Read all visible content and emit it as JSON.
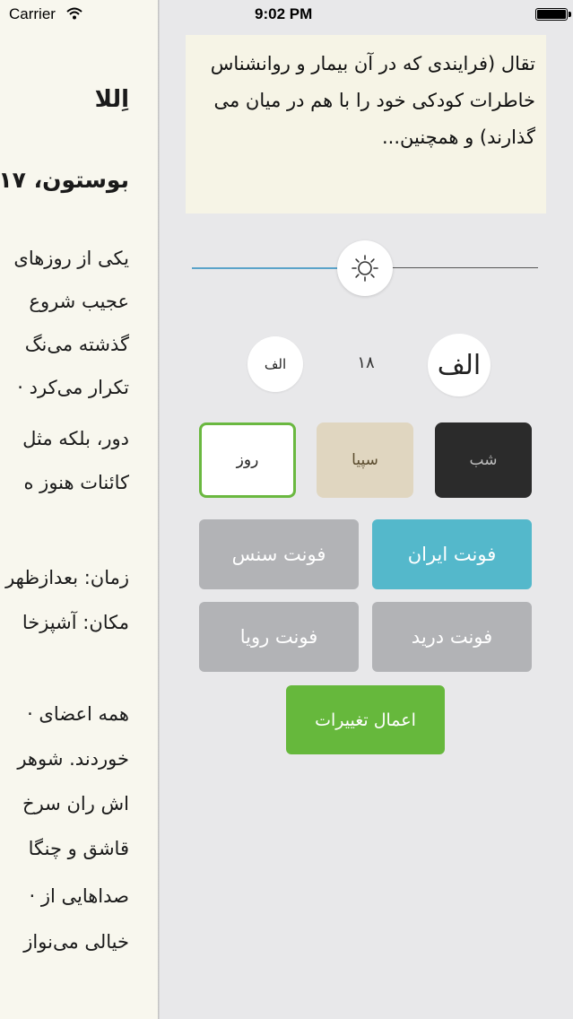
{
  "status_bar": {
    "carrier": "Carrier",
    "time": "9:02 PM"
  },
  "reader": {
    "title": "اِللا",
    "subtitle": "بوستون، ۱۷",
    "lines": [
      "یکی از روزهای",
      "عجیب شروع",
      "گذشته می‌نگ",
      "تکرار می‌کرد ·",
      "دور، بلکه مثل",
      "کائنات هنوز ه",
      "زمان: بعدازظهر",
      "مکان: آشپزخا",
      "همه اعضای ·",
      "خوردند. شوهر",
      "اش ران سرخ",
      "قاشق و چنگا",
      "صداهایی از ·",
      "خیالی می‌نواز"
    ]
  },
  "preview": {
    "text": "تقال (فرایندی که در آن بیمار و روانشناس خاطرات کودکی خود را با هم در میان می گذارند) و همچنین..."
  },
  "brightness": {
    "icon": "sun-icon",
    "level": 0.42
  },
  "font_size": {
    "larger_label": "الف",
    "smaller_label": "الف",
    "value": "۱۸"
  },
  "themes": {
    "day": "روز",
    "sepia": "سپیا",
    "night": "شب",
    "selected": "day"
  },
  "fonts": {
    "iran": "فونت ایران",
    "sans": "فونت سنس",
    "darivd": "فونت درید",
    "roya": "فونت رویا",
    "selected": "iran"
  },
  "apply_label": "اعمال تغییرات",
  "colors": {
    "panel_bg": "#e8e8ea",
    "accent_blue": "#54b8cb",
    "accent_green": "#66b83c",
    "font_button_gray": "#b2b3b6",
    "sepia": "#e0d6c0",
    "night": "#2b2b2b"
  }
}
